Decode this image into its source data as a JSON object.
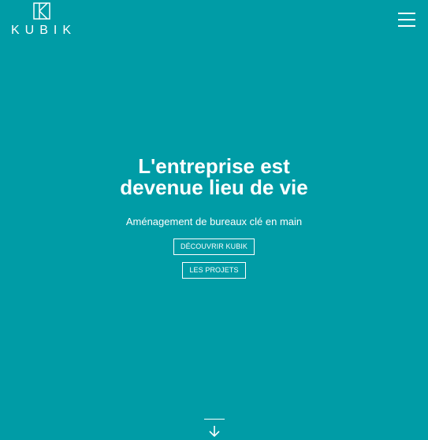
{
  "header": {
    "logo_text": "KUBIK",
    "menu_icon": "hamburger-icon"
  },
  "hero": {
    "title_line1": "L'entreprise est",
    "title_line2": "devenue lieu de vie",
    "subtitle": "Aménagement de bureaux clé en main",
    "cta_discover": "DÉCOUVRIR KUBIK",
    "cta_projects": "LES PROJETS"
  },
  "scroll": {
    "icon": "arrow-down-icon"
  },
  "colors": {
    "background": "#009ca6",
    "foreground": "#ffffff"
  }
}
